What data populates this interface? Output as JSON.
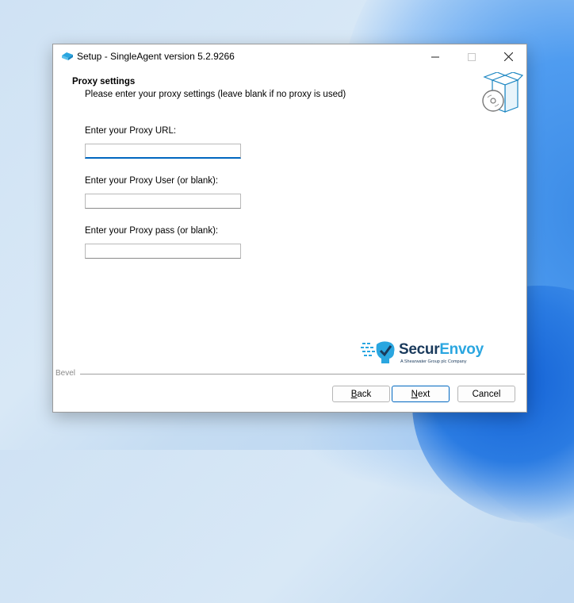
{
  "window": {
    "title": "Setup - SingleAgent version 5.2.9266"
  },
  "header": {
    "title": "Proxy settings",
    "subtitle": "Please enter your proxy settings (leave blank if no proxy is used)"
  },
  "fields": [
    {
      "label": "Enter your Proxy URL:",
      "value": ""
    },
    {
      "label": "Enter your Proxy User (or blank):",
      "value": ""
    },
    {
      "label": "Enter your Proxy pass (or blank):",
      "value": ""
    }
  ],
  "brand": {
    "name_part1": "Secur",
    "name_part2": "Envoy",
    "tagline": "A Shearwater Group plc Company",
    "colors": {
      "primary": "#1a3a5c",
      "accent": "#2aa6e0"
    }
  },
  "bevel": {
    "label": "Bevel"
  },
  "buttons": {
    "back_mnemonic": "B",
    "back_rest": "ack",
    "next_mnemonic": "N",
    "next_rest": "ext",
    "cancel": "Cancel"
  },
  "icons": {
    "app": "setup-icon",
    "box": "software-box-icon",
    "minimize": "minimize-icon",
    "maximize": "maximize-icon",
    "close": "close-icon",
    "brand": "securenvoy-logo-icon"
  },
  "colors": {
    "focus_accent": "#0067c0"
  }
}
